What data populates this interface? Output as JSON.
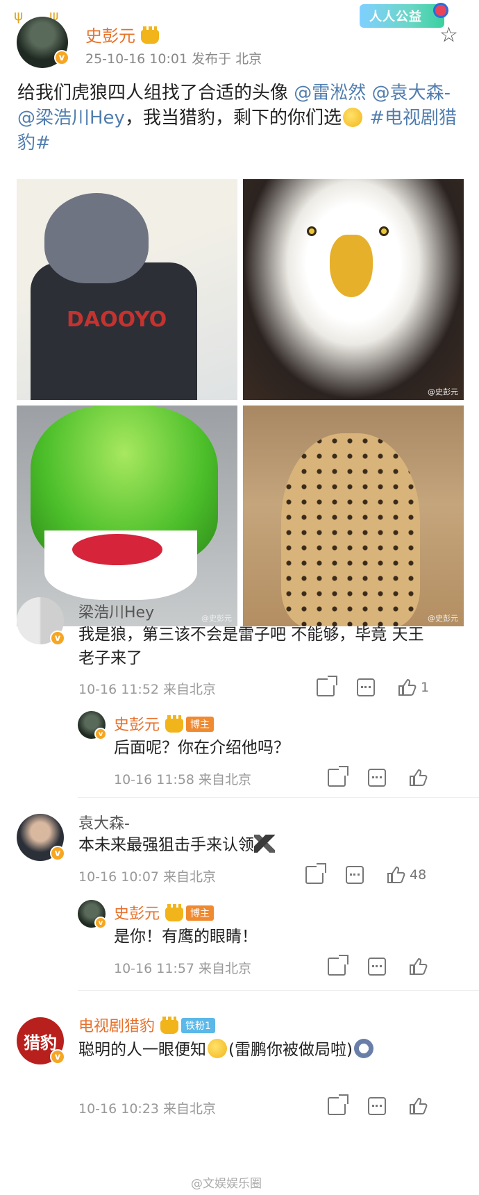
{
  "badge": {
    "label": "人人公益"
  },
  "post": {
    "author": "史彭元",
    "meta": "25-10-16 10:01   发布于 北京",
    "text_parts": {
      "a": "给我们虎狼四人组找了合适的头像",
      "m1": "@雷淞然",
      "m2": "@袁大森-",
      "m3": "@梁浩川Hey",
      "b": "，我当猎豹，剩下的你们选",
      "tag": "#电视剧猎豹#"
    },
    "image_watermark": "@史彭元"
  },
  "comments": [
    {
      "name": "梁浩川Hey",
      "text": "我是狼，第三该不会是雷子吧 不能够，毕竟 天王老子来了",
      "meta": "10-16 11:52  来自北京",
      "likes": "1",
      "reply": {
        "name": "史彭元",
        "tag": "博主",
        "text": "后面呢？你在介绍他吗？",
        "meta": "10-16 11:58  来自北京"
      }
    },
    {
      "name": "袁大森-",
      "text": "本未来最强狙击手来认领",
      "meta": "10-16 10:07  来自北京",
      "likes": "48",
      "reply": {
        "name": "史彭元",
        "tag": "博主",
        "text": "是你！有鹰的眼睛！",
        "meta": "10-16 11:57  来自北京"
      }
    },
    {
      "name": "电视剧猎豹",
      "tag": "铁粉1",
      "avatar_text": "猎豹",
      "text": "聪明的人一眼便知",
      "text_tail": "(雷鹏你被做局啦)",
      "meta": "10-16 10:23  来自北京"
    }
  ],
  "footer_watermark": "@文娱娱乐圈",
  "icons": [
    "star-icon",
    "verified-icon",
    "crown-icon",
    "share-icon",
    "comment-icon",
    "like-icon",
    "emoji-icon",
    "eagle-emoji-icon"
  ],
  "colors": {
    "accent": "#e8702a",
    "link": "#507daf",
    "meta": "#999999"
  }
}
